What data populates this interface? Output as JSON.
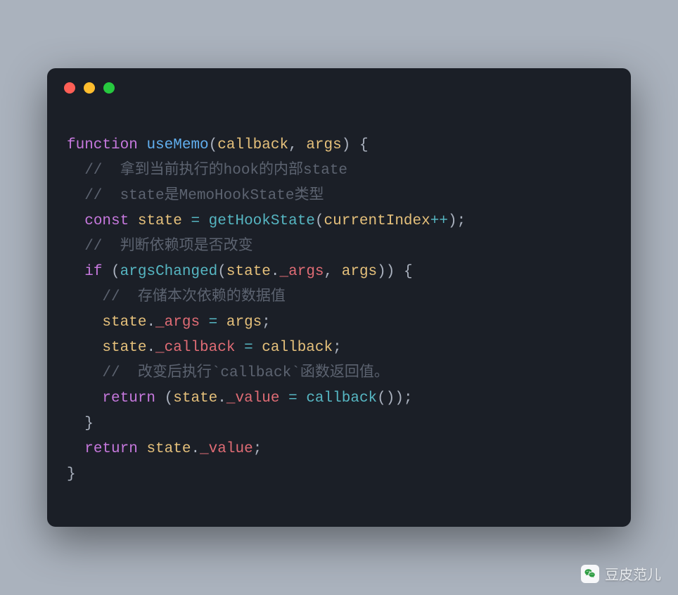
{
  "window": {
    "traffic_lights": [
      "close",
      "minimize",
      "zoom"
    ]
  },
  "code": {
    "l1": {
      "kw": "function",
      "fn": "useMemo",
      "p_open": "(",
      "arg1": "callback",
      "comma": ", ",
      "arg2": "args",
      "p_close": ") {"
    },
    "l2": "  //  拿到当前执行的hook的内部state",
    "l3": "  //  state是MemoHookState类型",
    "l4": {
      "indent": "  ",
      "kw": "const",
      "name": "state",
      "eq": " = ",
      "call": "getHookState",
      "p_open": "(",
      "arg": "currentIndex",
      "inc": "++",
      "p_close": ");"
    },
    "l5": "  //  判断依赖项是否改变",
    "l6": {
      "indent": "  ",
      "kw": "if",
      "p_open": " (",
      "call": "argsChanged",
      "p2_open": "(",
      "obj": "state",
      "dot": ".",
      "prop": "_args",
      "comma": ", ",
      "arg": "args",
      "p2_close": ")",
      "p_close": ") {"
    },
    "l7": "    //  存储本次依赖的数据值",
    "l8": {
      "indent": "    ",
      "obj": "state",
      "dot": ".",
      "prop": "_args",
      "eq": " = ",
      "rhs": "args",
      "semi": ";"
    },
    "l9": {
      "indent": "    ",
      "obj": "state",
      "dot": ".",
      "prop": "_callback",
      "eq": " = ",
      "rhs": "callback",
      "semi": ";"
    },
    "l10": "    //  改变后执行`callback`函数返回值。",
    "l11": {
      "indent": "    ",
      "kw": "return",
      "sp": " (",
      "obj": "state",
      "dot": ".",
      "prop": "_value",
      "eq": " = ",
      "call": "callback",
      "p_open": "(",
      "p_close": "));"
    },
    "l12": "  }",
    "l13": {
      "indent": "  ",
      "kw": "return",
      "sp": " ",
      "obj": "state",
      "dot": ".",
      "prop": "_value",
      "semi": ";"
    },
    "l14": "}"
  },
  "watermark": {
    "label": "豆皮范儿"
  }
}
